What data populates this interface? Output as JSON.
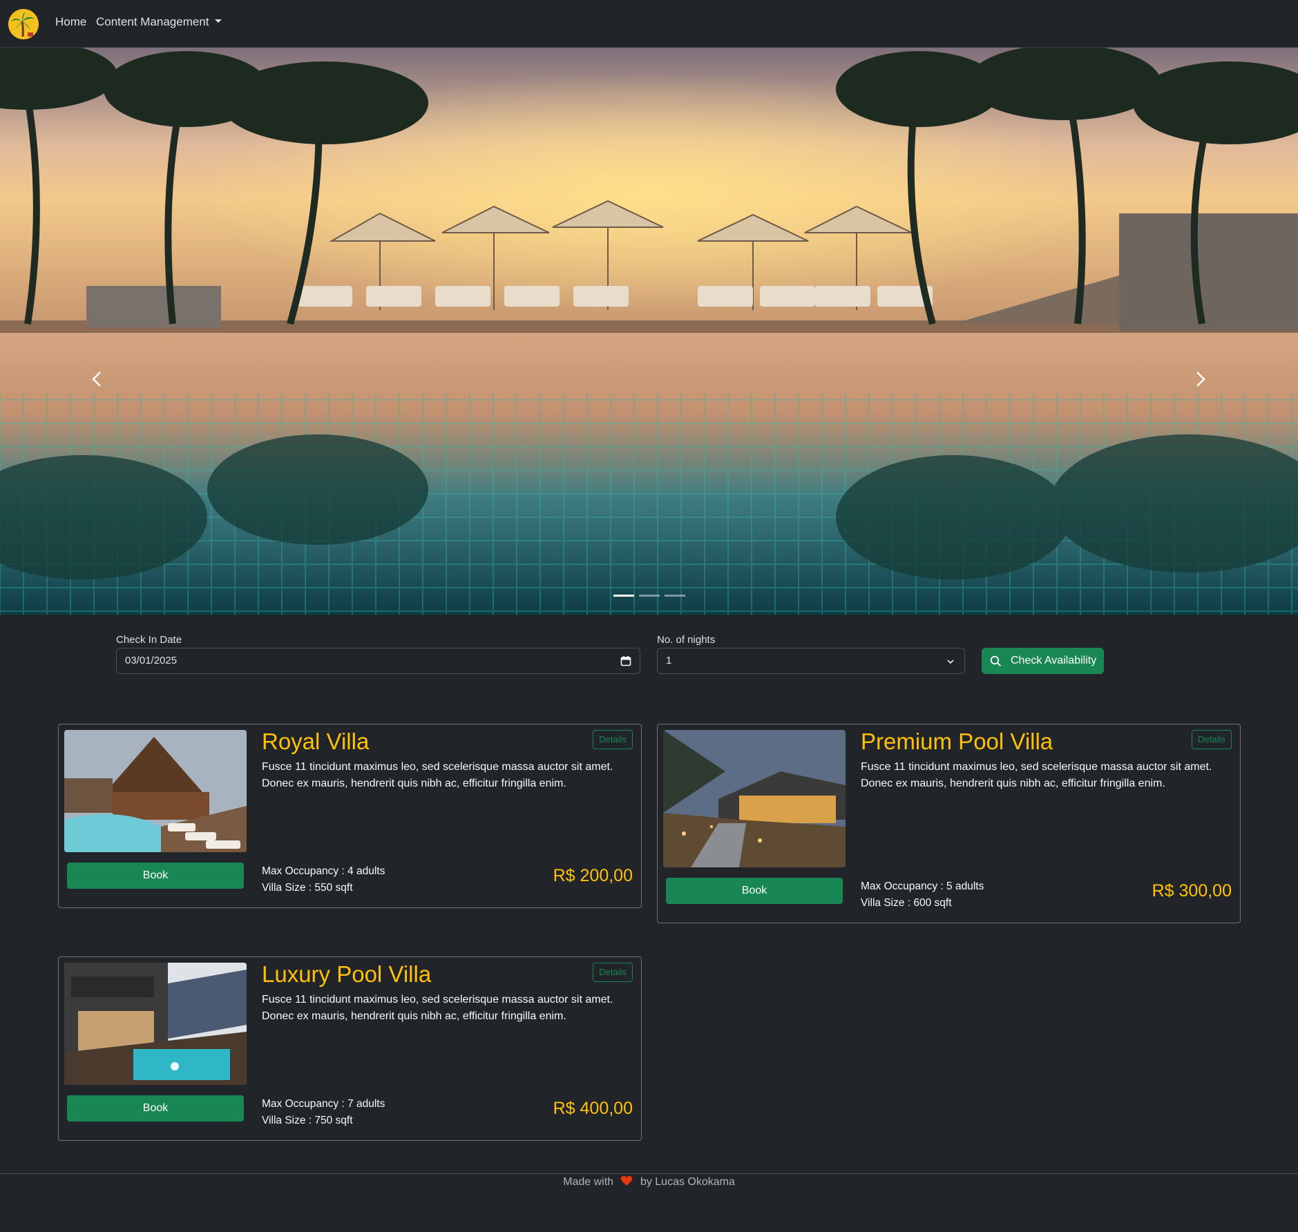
{
  "navbar": {
    "logo_icon": "palm-tree-logo-icon",
    "links": {
      "home": "Home",
      "content_management": "Content Management"
    }
  },
  "hero": {
    "image": "resort-pool-sunset-with-palm-trees-and-umbrellas",
    "slides_count": 3,
    "active_slide": 1
  },
  "search": {
    "check_in_label": "Check In Date",
    "check_in_value": "03/01/2025",
    "nights_label": "No. of nights",
    "nights_value": "1",
    "button_label": "Check Availability"
  },
  "villas": [
    {
      "name": "Royal Villa",
      "details_label": "Details",
      "description": "Fusce 11 tincidunt maximus leo, sed scelerisque massa auctor sit amet. Donec ex mauris, hendrerit quis nibh ac, efficitur fringilla enim.",
      "occupancy": "Max Occupancy : 4 adults",
      "size": "Villa Size : 550 sqft",
      "price": "R$ 200,00",
      "book_label": "Book",
      "image": "villa-with-pool-and-loungers"
    },
    {
      "name": "Premium Pool Villa",
      "details_label": "Details",
      "description": "Fusce 11 tincidunt maximus leo, sed scelerisque massa auctor sit amet. Donec ex mauris, hendrerit quis nibh ac, efficitur fringilla enim.",
      "occupancy": "Max Occupancy : 5 adults",
      "size": "Villa Size : 600 sqft",
      "price": "R$ 300,00",
      "book_label": "Book",
      "image": "modern-villa-at-dusk-with-pathway"
    },
    {
      "name": "Luxury Pool Villa",
      "details_label": "Details",
      "description": "Fusce 11 tincidunt maximus leo, sed scelerisque massa auctor sit amet. Donec ex mauris, hendrerit quis nibh ac, efficitur fringilla enim.",
      "occupancy": "Max Occupancy : 7 adults",
      "size": "Villa Size : 750 sqft",
      "price": "R$ 400,00",
      "book_label": "Book",
      "image": "modern-house-with-lit-plunge-pool"
    }
  ],
  "footer": {
    "made_with": "Made with",
    "by": "by Lucas Okokama",
    "heart_icon": "heart-icon"
  },
  "colors": {
    "background": "#212529",
    "accent_green": "#198754",
    "price_yellow": "#ffc107"
  }
}
